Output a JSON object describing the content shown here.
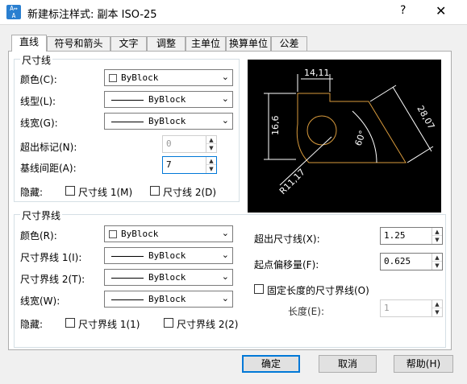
{
  "window": {
    "title": "新建标注样式: 副本 ISO-25",
    "help": "?",
    "close": "✕"
  },
  "tabs": [
    "直线",
    "符号和箭头",
    "文字",
    "调整",
    "主单位",
    "换算单位",
    "公差"
  ],
  "dim_line": {
    "legend": "尺寸线",
    "color_label": "颜色(C):",
    "color_value": "ByBlock",
    "linetype_label": "线型(L):",
    "linetype_value": "ByBlock",
    "lineweight_label": "线宽(G):",
    "lineweight_value": "ByBlock",
    "extend_label": "超出标记(N):",
    "extend_value": "0",
    "baseline_label": "基线间距(A):",
    "baseline_value": "7",
    "suppress_label": "隐藏:",
    "suppress1": "尺寸线 1(M)",
    "suppress2": "尺寸线 2(D)"
  },
  "ext_line": {
    "legend": "尺寸界线",
    "color_label": "颜色(R):",
    "color_value": "ByBlock",
    "lt1_label": "尺寸界线 1(I):",
    "lt1_value": "ByBlock",
    "lt2_label": "尺寸界线 2(T):",
    "lt2_value": "ByBlock",
    "lineweight_label": "线宽(W):",
    "lineweight_value": "ByBlock",
    "suppress_label": "隐藏:",
    "suppress1": "尺寸界线 1(1)",
    "suppress2": "尺寸界线 2(2)",
    "beyond_label": "超出尺寸线(X):",
    "beyond_value": "1.25",
    "offset_label": "起点偏移量(F):",
    "offset_value": "0.625",
    "fixed_label": "固定长度的尺寸界线(O)",
    "length_label": "长度(E):",
    "length_value": "1"
  },
  "preview": {
    "dim_top": "14,11",
    "dim_left": "16,6",
    "dim_right": "28,07",
    "dim_angle": "60°",
    "dim_radius": "R11,17",
    "line_color": "#d89a3c"
  },
  "buttons": {
    "ok": "确定",
    "cancel": "取消",
    "help": "帮助(H)"
  }
}
